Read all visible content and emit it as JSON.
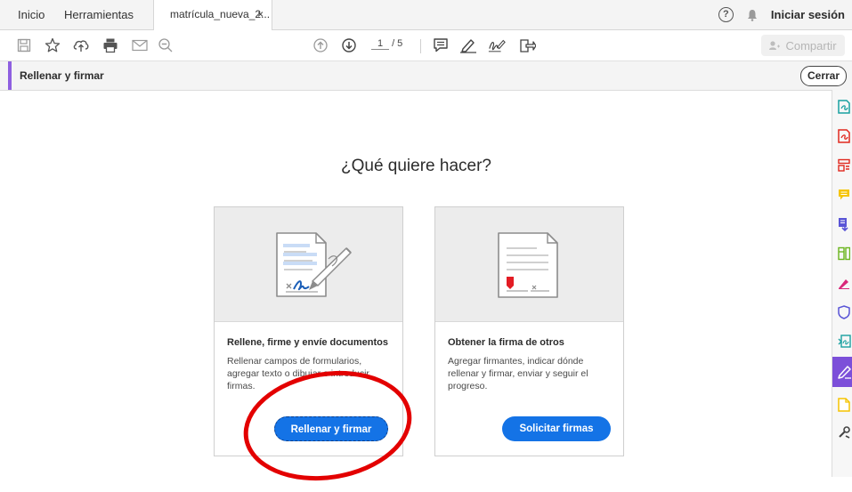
{
  "tabs": {
    "home": "Inicio",
    "tools": "Herramientas",
    "document": "matrícula_nueva_2...",
    "close_symbol": "×"
  },
  "topbar": {
    "help_symbol": "?",
    "signin": "Iniciar sesión"
  },
  "toolbar": {
    "page_current": "1",
    "page_total": "/ 5",
    "share": "Compartir"
  },
  "tool_header": {
    "title": "Rellenar y firmar",
    "close": "Cerrar",
    "accent_color": "#8e5fe0"
  },
  "main": {
    "heading": "¿Qué quiere hacer?",
    "cards": [
      {
        "title": "Rellene, firme y envíe documentos",
        "description": "Rellenar campos de formularios, agregar texto o dibujar o introducir firmas.",
        "button": "Rellenar y firmar"
      },
      {
        "title": "Obtener la firma de otros",
        "description": "Agregar firmantes, indicar dónde rellenar y firmar, enviar y seguir el progreso.",
        "button": "Solicitar firmas"
      }
    ]
  },
  "colors": {
    "primary_button": "#1473e6",
    "highlight_ring": "#e30000",
    "rail_active": "#7c4fd9"
  }
}
